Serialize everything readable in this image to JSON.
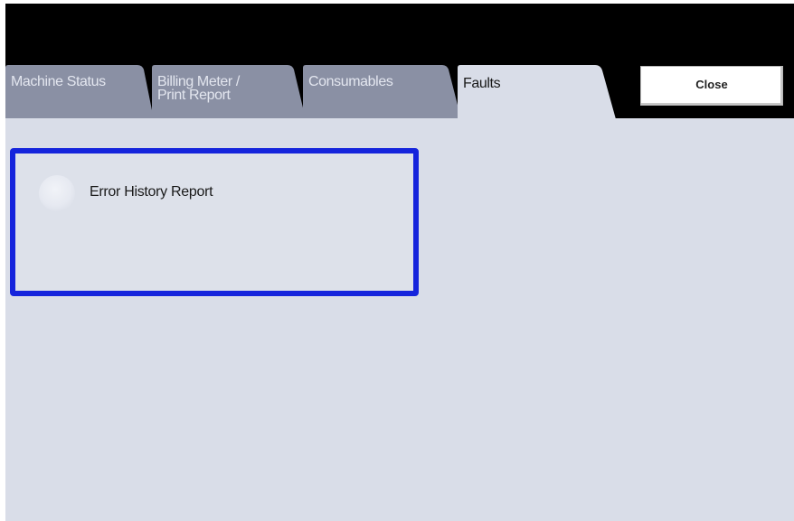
{
  "tabs": [
    {
      "label": "Machine Status",
      "active": false
    },
    {
      "label": "Billing Meter /\nPrint Report",
      "active": false
    },
    {
      "label": "Consumables",
      "active": false
    },
    {
      "label": "Faults",
      "active": true
    }
  ],
  "close_button": {
    "label": "Close"
  },
  "faults_panel": {
    "options": [
      {
        "label": "Error History Report",
        "selected": false
      }
    ]
  },
  "colors": {
    "inactive_tab": "#8a90a4",
    "active_tab": "#d9dde8",
    "panel": "#d9dde8",
    "selection_border": "#1524dc",
    "top_bar": "#000000"
  }
}
